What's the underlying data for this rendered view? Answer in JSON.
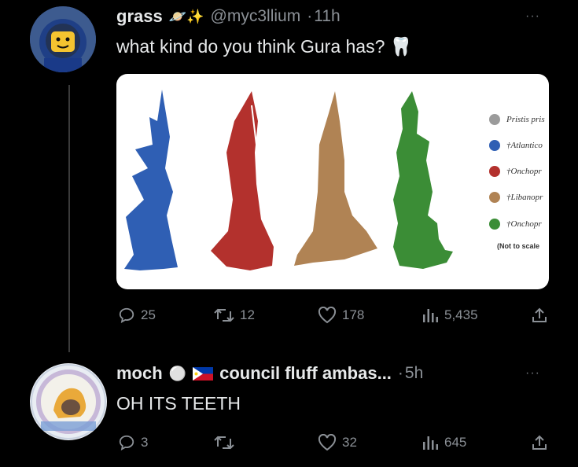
{
  "tweet": {
    "name": "grass",
    "name_emoji": "🪐✨",
    "handle": "@myc3llium",
    "separator": "·",
    "time": "11h",
    "text": "what kind do you think Gura has?",
    "text_emoji": "🦷",
    "more": "···",
    "image": {
      "legend": [
        {
          "label": "Pristis pris",
          "color": "#9b9b9b"
        },
        {
          "label": "†Atlantico",
          "color": "#2f5fb4"
        },
        {
          "label": "†Onchopr",
          "color": "#b3312d"
        },
        {
          "label": "†Libanopr",
          "color": "#b08354"
        },
        {
          "label": "†Onchopr",
          "color": "#3b8d36"
        }
      ],
      "note": "(Not to scale"
    },
    "stats": {
      "replies": "25",
      "retweets": "12",
      "likes": "178",
      "views": "5,435"
    }
  },
  "reply": {
    "name": "moch",
    "name_emoji": "⚪",
    "display_rest": "council fluff ambas...",
    "separator": "·",
    "time": "5h",
    "text": "OH ITS TEETH",
    "more": "···",
    "stats": {
      "replies": "3",
      "retweets": "",
      "likes": "32",
      "views": "645"
    }
  },
  "colors": {
    "background": "#000000",
    "text": "#e7e9ea",
    "muted": "#8b9096",
    "tooth_blue": "#2f5fb4",
    "tooth_red": "#b3312d",
    "tooth_tan": "#b08354",
    "tooth_green": "#3b8d36"
  }
}
